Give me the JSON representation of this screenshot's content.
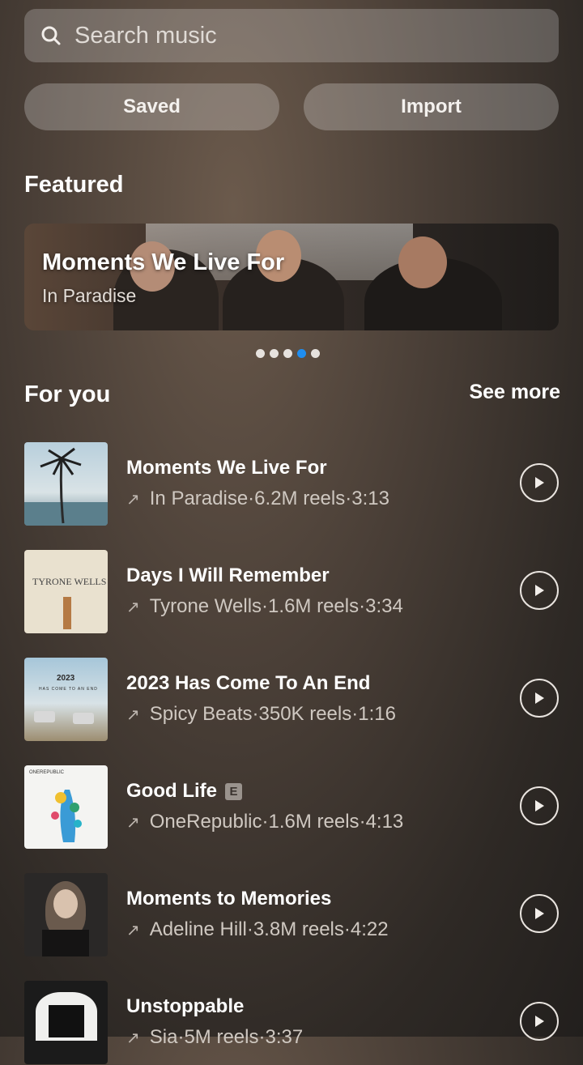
{
  "search": {
    "placeholder": "Search music"
  },
  "buttons": {
    "saved": "Saved",
    "import": "Import"
  },
  "featured": {
    "heading": "Featured",
    "banner_title": "Moments We Live For",
    "banner_subtitle": "In Paradise",
    "pager_total": 5,
    "pager_active": 4
  },
  "for_you": {
    "heading": "For you",
    "see_more": "See more",
    "tracks": [
      {
        "title": "Moments We Live For",
        "artist": "In Paradise",
        "reels": "6.2M reels",
        "duration": "3:13",
        "explicit": false
      },
      {
        "title": "Days I Will Remember",
        "artist": "Tyrone Wells",
        "reels": "1.6M reels",
        "duration": "3:34",
        "explicit": false
      },
      {
        "title": "2023 Has Come To An End",
        "artist": "Spicy Beats",
        "reels": "350K reels",
        "duration": "1:16",
        "explicit": false
      },
      {
        "title": "Good Life",
        "artist": "OneRepublic",
        "reels": "1.6M reels",
        "duration": "4:13",
        "explicit": true,
        "badge": "E"
      },
      {
        "title": "Moments to Memories",
        "artist": "Adeline Hill",
        "reels": "3.8M reels",
        "duration": "4:22",
        "explicit": false
      },
      {
        "title": "Unstoppable",
        "artist": "Sia",
        "reels": "5M reels",
        "duration": "3:37",
        "explicit": false
      }
    ]
  },
  "album_art_text": {
    "tyrone": "TYRONE WELLS",
    "year": "2023",
    "year_sub": "HAS COME TO AN END",
    "onerepublic": "ONEREPUBLIC"
  },
  "separator": " · ",
  "colors": {
    "accent": "#1f8ef1",
    "background": "#3b332d"
  },
  "icons": {
    "search": "search-icon",
    "trend": "trend-arrow-icon",
    "play": "play-icon"
  }
}
